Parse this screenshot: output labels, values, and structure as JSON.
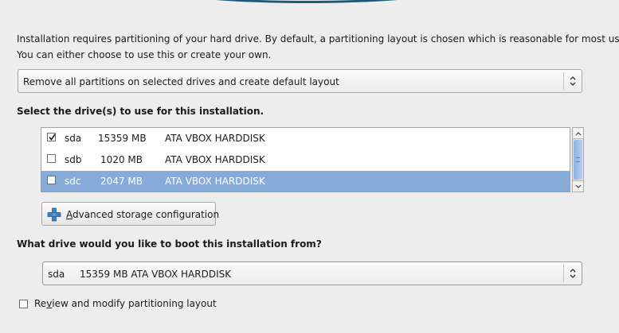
{
  "intro": {
    "line1": "Installation requires partitioning of your hard drive.  By default, a partitioning layout is chosen which is reasonable for most users.",
    "line2": "You can either choose to use this or create your own."
  },
  "layout_select": {
    "value": "Remove all partitions on selected drives and create default layout"
  },
  "drives_section": {
    "label": "Select the drive(s) to use for this installation.",
    "drives": [
      {
        "name": "sda",
        "size": "15359 MB",
        "model": "ATA VBOX HARDDISK",
        "checked": true,
        "selected": false
      },
      {
        "name": "sdb",
        "size": "1020 MB",
        "model": "ATA VBOX HARDDISK",
        "checked": false,
        "selected": false
      },
      {
        "name": "sdc",
        "size": "2047 MB",
        "model": "ATA VBOX HARDDISK",
        "checked": false,
        "selected": true
      }
    ]
  },
  "advanced_button": {
    "mnemonic": "A",
    "rest": "dvanced storage configuration"
  },
  "boot_section": {
    "label": "What drive would you like to boot this installation from?",
    "selected_name": "sda",
    "selected_detail": "15359 MB ATA VBOX HARDDISK"
  },
  "review_checkbox": {
    "before": "Re",
    "mnemonic": "v",
    "after": "iew and modify partitioning layout",
    "checked": false
  },
  "colors": {
    "selection": "#86abd9",
    "accent": "#1d5a7a"
  }
}
